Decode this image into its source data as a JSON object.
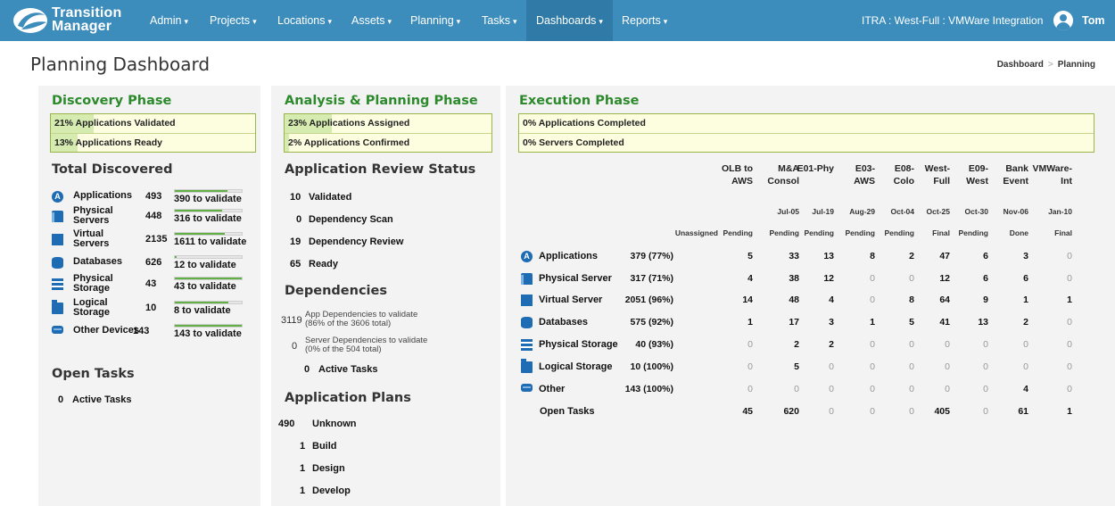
{
  "nav": {
    "brand_line1": "Transition",
    "brand_line2": "Manager",
    "menu": [
      {
        "label": "Admin"
      },
      {
        "label": "Projects"
      },
      {
        "label": "Locations"
      },
      {
        "label": "Assets"
      },
      {
        "label": "Planning"
      },
      {
        "label": "Tasks"
      },
      {
        "label": "Dashboards"
      },
      {
        "label": "Reports"
      }
    ],
    "active_menu": "Dashboards",
    "project": "ITRA : West-Full : VMWare Integration",
    "user": "Tom",
    "caret": "▾"
  },
  "page": {
    "title": "Planning Dashboard",
    "breadcrumb": [
      "Dashboard",
      "Planning"
    ],
    "breadcrumb_sep": ">"
  },
  "discovery": {
    "title": "Discovery Phase",
    "progress": [
      {
        "pct": "21%",
        "text": " Applications Validated",
        "value": 21
      },
      {
        "pct": "13%",
        "text": " Applications Ready",
        "value": 13
      }
    ],
    "total_title": "Total Discovered",
    "rows": [
      {
        "icon": "application-icon",
        "label": "Applications",
        "count": "493",
        "validate": "390 to validate",
        "frac": 0.79
      },
      {
        "icon": "physical-server-icon",
        "label": "Physical Servers",
        "count": "448",
        "validate": "316 to validate",
        "frac": 0.71
      },
      {
        "icon": "virtual-server-icon",
        "label": "Virtual Servers",
        "count": "2135",
        "validate": "1611 to validate",
        "frac": 0.75
      },
      {
        "icon": "database-icon",
        "label": "Databases",
        "count": "626",
        "validate": "12 to validate",
        "frac": 0.02
      },
      {
        "icon": "physical-storage-icon",
        "label": "Physical Storage",
        "count": "43",
        "validate": "43 to validate",
        "frac": 1.0
      },
      {
        "icon": "logical-storage-icon",
        "label": "Logical Storage",
        "count": "10",
        "validate": "8 to validate",
        "frac": 0.8
      },
      {
        "icon": "other-devices-icon",
        "label": "Other Devices",
        "count": "143",
        "validate": "143 to validate",
        "frac": 1.0
      }
    ],
    "open_tasks_title": "Open Tasks",
    "open_tasks": {
      "count": "0",
      "label": "Active Tasks"
    }
  },
  "analysis": {
    "title": "Analysis & Planning Phase",
    "progress": [
      {
        "pct": "23%",
        "text": " Applications Assigned",
        "value": 23
      },
      {
        "pct": "2%",
        "text": " Applications Confirmed",
        "value": 2
      }
    ],
    "review_title": "Application Review Status",
    "review": [
      {
        "n": "10",
        "label": "Validated"
      },
      {
        "n": "0",
        "label": "Dependency Scan"
      },
      {
        "n": "19",
        "label": "Dependency Review"
      },
      {
        "n": "65",
        "label": "Ready"
      }
    ],
    "deps_title": "Dependencies",
    "deps": [
      {
        "n": "3119",
        "l1": "App Dependencies to validate",
        "l2": "(86% of the 3606 total)"
      },
      {
        "n": "0",
        "l1": "Server Dependencies to validate",
        "l2": "(0% of the 504 total)"
      }
    ],
    "deps_tasks": {
      "n": "0",
      "label": "Active Tasks"
    },
    "plans_title": "Application Plans",
    "plans": [
      {
        "n": "490",
        "label": "Unknown"
      },
      {
        "n": "1",
        "label": "Build"
      },
      {
        "n": "1",
        "label": "Design"
      },
      {
        "n": "1",
        "label": "Develop"
      }
    ]
  },
  "execution": {
    "title": "Execution Phase",
    "progress": [
      {
        "pct": "0%",
        "text": " Applications Completed",
        "value": 0
      },
      {
        "pct": "0%",
        "text": " Servers Completed",
        "value": 0
      }
    ],
    "events": [
      {
        "l1": "OLB to",
        "l2": "AWS",
        "date": "",
        "status": "Pending"
      },
      {
        "l1": "M&A",
        "l2": "Consol",
        "date": "Jul-05",
        "status": "Pending"
      },
      {
        "l1": "E01-Phy",
        "l2": "",
        "date": "Jul-19",
        "status": "Pending"
      },
      {
        "l1": "E03-",
        "l2": "AWS",
        "date": "Aug-29",
        "status": "Pending"
      },
      {
        "l1": "E08-",
        "l2": "Colo",
        "date": "Oct-04",
        "status": "Pending"
      },
      {
        "l1": "West-",
        "l2": "Full",
        "date": "Oct-25",
        "status": "Final"
      },
      {
        "l1": "E09-",
        "l2": "West",
        "date": "Oct-30",
        "status": "Pending"
      },
      {
        "l1": "Bank",
        "l2": "Event",
        "date": "Nov-06",
        "status": "Done"
      },
      {
        "l1": "VMWare-",
        "l2": "Int",
        "date": "Jan-10",
        "status": "Final"
      }
    ],
    "unassigned_header": "Unassigned",
    "rows": [
      {
        "icon": "application-icon",
        "label": "Applications",
        "unassigned": "379 (77%)",
        "values": [
          "5",
          "33",
          "13",
          "8",
          "2",
          "47",
          "6",
          "3",
          "0"
        ]
      },
      {
        "icon": "physical-server-icon",
        "label": "Physical Server",
        "unassigned": "317 (71%)",
        "values": [
          "4",
          "38",
          "12",
          "0",
          "0",
          "12",
          "6",
          "6",
          "0"
        ]
      },
      {
        "icon": "virtual-server-icon",
        "label": "Virtual Server",
        "unassigned": "2051 (96%)",
        "values": [
          "14",
          "48",
          "4",
          "0",
          "8",
          "64",
          "9",
          "1",
          "1"
        ]
      },
      {
        "icon": "database-icon",
        "label": "Databases",
        "unassigned": "575 (92%)",
        "values": [
          "1",
          "17",
          "3",
          "1",
          "5",
          "41",
          "13",
          "2",
          "0"
        ]
      },
      {
        "icon": "physical-storage-icon",
        "label": "Physical Storage",
        "unassigned": "40 (93%)",
        "values": [
          "0",
          "2",
          "2",
          "0",
          "0",
          "0",
          "0",
          "0",
          "0"
        ]
      },
      {
        "icon": "logical-storage-icon",
        "label": "Logical Storage",
        "unassigned": "10 (100%)",
        "values": [
          "0",
          "5",
          "0",
          "0",
          "0",
          "0",
          "0",
          "0",
          "0"
        ]
      },
      {
        "icon": "other-icon",
        "label": "Other",
        "unassigned": "143 (100%)",
        "values": [
          "0",
          "0",
          "0",
          "0",
          "0",
          "0",
          "0",
          "4",
          "0"
        ]
      },
      {
        "icon": "",
        "label": "Open Tasks",
        "unassigned": "",
        "values": [
          "45",
          "620",
          "0",
          "0",
          "0",
          "405",
          "0",
          "61",
          "1"
        ]
      }
    ]
  }
}
